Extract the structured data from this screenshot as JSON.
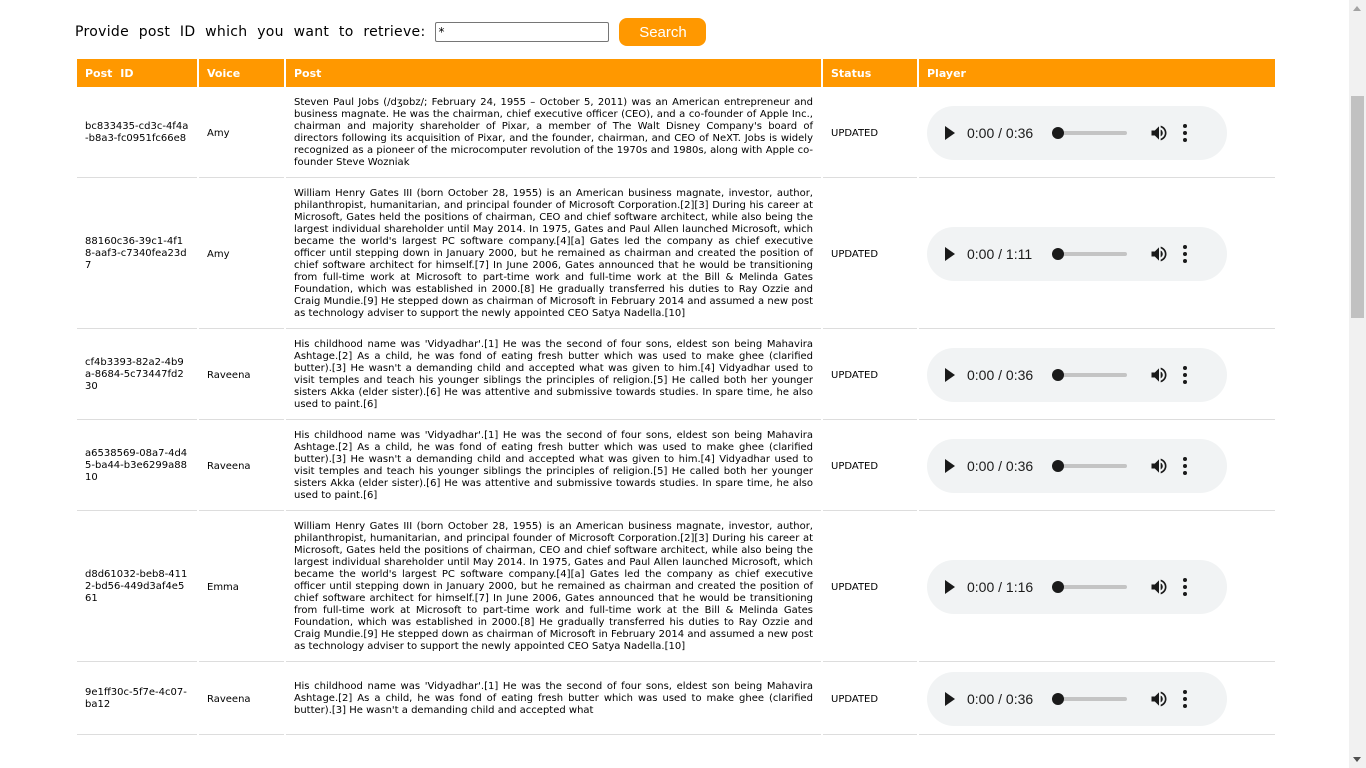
{
  "search": {
    "label": "Provide post ID which you want to retrieve:",
    "input_value": "*",
    "button_label": "Search"
  },
  "table": {
    "headers": [
      "Post ID",
      "Voice",
      "Post",
      "Status",
      "Player"
    ],
    "rows": [
      {
        "post_id": "bc833435-cd3c-4f4a-b8a3-fc0951fc66e8",
        "voice": "Amy",
        "post": "Steven Paul Jobs (/dʒɒbz/; February 24, 1955 – October 5, 2011) was an American entrepreneur and business magnate. He was the chairman, chief executive officer (CEO), and a co-founder of Apple Inc., chairman and majority shareholder of Pixar, a member of The Walt Disney Company's board of directors following its acquisition of Pixar, and the founder, chairman, and CEO of NeXT. Jobs is widely recognized as a pioneer of the microcomputer revolution of the 1970s and 1980s, along with Apple co-founder Steve Wozniak",
        "status": "UPDATED",
        "time": "0:00 / 0:36"
      },
      {
        "post_id": "88160c36-39c1-4f18-aaf3-c7340fea23d7",
        "voice": "Amy",
        "post": "William Henry Gates III (born October 28, 1955) is an American business magnate, investor, author, philanthropist, humanitarian, and principal founder of Microsoft Corporation.[2][3] During his career at Microsoft, Gates held the positions of chairman, CEO and chief software architect, while also being the largest individual shareholder until May 2014. In 1975, Gates and Paul Allen launched Microsoft, which became the world's largest PC software company.[4][a] Gates led the company as chief executive officer until stepping down in January 2000, but he remained as chairman and created the position of chief software architect for himself.[7] In June 2006, Gates announced that he would be transitioning from full-time work at Microsoft to part-time work and full-time work at the Bill & Melinda Gates Foundation, which was established in 2000.[8] He gradually transferred his duties to Ray Ozzie and Craig Mundie.[9] He stepped down as chairman of Microsoft in February 2014 and assumed a new post as technology adviser to support the newly appointed CEO Satya Nadella.[10]",
        "status": "UPDATED",
        "time": "0:00 / 1:11"
      },
      {
        "post_id": "cf4b3393-82a2-4b9a-8684-5c73447fd230",
        "voice": "Raveena",
        "post": "His childhood name was 'Vidyadhar'.[1] He was the second of four sons, eldest son being Mahavira Ashtage.[2] As a child, he was fond of eating fresh butter which was used to make ghee (clarified butter).[3] He wasn't a demanding child and accepted what was given to him.[4] Vidyadhar used to visit temples and teach his younger siblings the principles of religion.[5] He called both her younger sisters Akka (elder sister).[6] He was attentive and submissive towards studies. In spare time, he also used to paint.[6]",
        "status": "UPDATED",
        "time": "0:00 / 0:36"
      },
      {
        "post_id": "a6538569-08a7-4d45-ba44-b3e6299a8810",
        "voice": "Raveena",
        "post": "His childhood name was 'Vidyadhar'.[1] He was the second of four sons, eldest son being Mahavira Ashtage.[2] As a child, he was fond of eating fresh butter which was used to make ghee (clarified butter).[3] He wasn't a demanding child and accepted what was given to him.[4] Vidyadhar used to visit temples and teach his younger siblings the principles of religion.[5] He called both her younger sisters Akka (elder sister).[6] He was attentive and submissive towards studies. In spare time, he also used to paint.[6]",
        "status": "UPDATED",
        "time": "0:00 / 0:36"
      },
      {
        "post_id": "d8d61032-beb8-4112-bd56-449d3af4e561",
        "voice": "Emma",
        "post": "William Henry Gates III (born October 28, 1955) is an American business magnate, investor, author, philanthropist, humanitarian, and principal founder of Microsoft Corporation.[2][3] During his career at Microsoft, Gates held the positions of chairman, CEO and chief software architect, while also being the largest individual shareholder until May 2014. In 1975, Gates and Paul Allen launched Microsoft, which became the world's largest PC software company.[4][a] Gates led the company as chief executive officer until stepping down in January 2000, but he remained as chairman and created the position of chief software architect for himself.[7] In June 2006, Gates announced that he would be transitioning from full-time work at Microsoft to part-time work and full-time work at the Bill & Melinda Gates Foundation, which was established in 2000.[8] He gradually transferred his duties to Ray Ozzie and Craig Mundie.[9] He stepped down as chairman of Microsoft in February 2014 and assumed a new post as technology adviser to support the newly appointed CEO Satya Nadella.[10]",
        "status": "UPDATED",
        "time": "0:00 / 1:16"
      },
      {
        "post_id": "9e1ff30c-5f7e-4c07-ba12",
        "voice": "Raveena",
        "post": "His childhood name was 'Vidyadhar'.[1] He was the second of four sons, eldest son being Mahavira Ashtage.[2] As a child, he was fond of eating fresh butter which was used to make ghee (clarified butter).[3] He wasn't a demanding child and accepted what",
        "status": "UPDATED",
        "time": "0:00 / 0:36"
      }
    ]
  },
  "icons": {
    "play": "play-icon",
    "volume": "volume-icon",
    "more": "more-options-icon"
  },
  "colors": {
    "accent": "#ff9800",
    "player_bg": "#f1f3f4"
  }
}
